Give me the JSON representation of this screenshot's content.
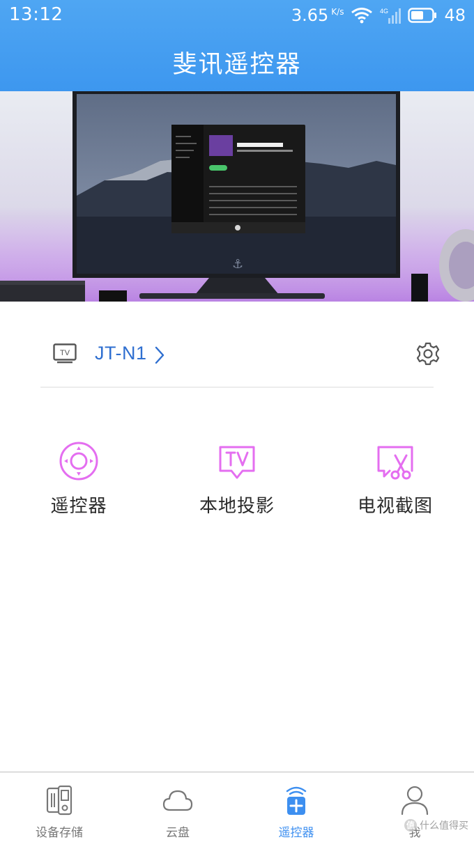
{
  "status_bar": {
    "time": "13:12",
    "net_speed": "3.65",
    "net_unit": "K/s",
    "signal_type": "4G",
    "battery": "48",
    "icons": [
      "wifi-icon",
      "signal-icon",
      "battery-icon"
    ]
  },
  "app": {
    "title": "斐讯遥控器"
  },
  "hero": {
    "image": "tv-mountain-photo"
  },
  "device": {
    "tv_badge": "TV",
    "name": "JT-N1"
  },
  "features": [
    {
      "label": "遥控器",
      "icon": "remote-dial-icon"
    },
    {
      "label": "本地投影",
      "icon": "tv-cast-icon"
    },
    {
      "label": "电视截图",
      "icon": "screenshot-scissors-icon"
    }
  ],
  "nav": {
    "items": [
      {
        "label": "设备存储",
        "icon": "storage-icon",
        "active": false
      },
      {
        "label": "云盘",
        "icon": "cloud-icon",
        "active": false
      },
      {
        "label": "遥控器",
        "icon": "remote-icon",
        "active": true
      },
      {
        "label": "我",
        "icon": "user-icon",
        "active": false
      }
    ]
  },
  "watermark": {
    "badge": "值",
    "text": "什么值得买"
  },
  "colors": {
    "header": "#4fa6f3",
    "accent": "#3d8ff0",
    "device_name": "#2f6fd0",
    "feature_icon": "#e46ef0"
  }
}
